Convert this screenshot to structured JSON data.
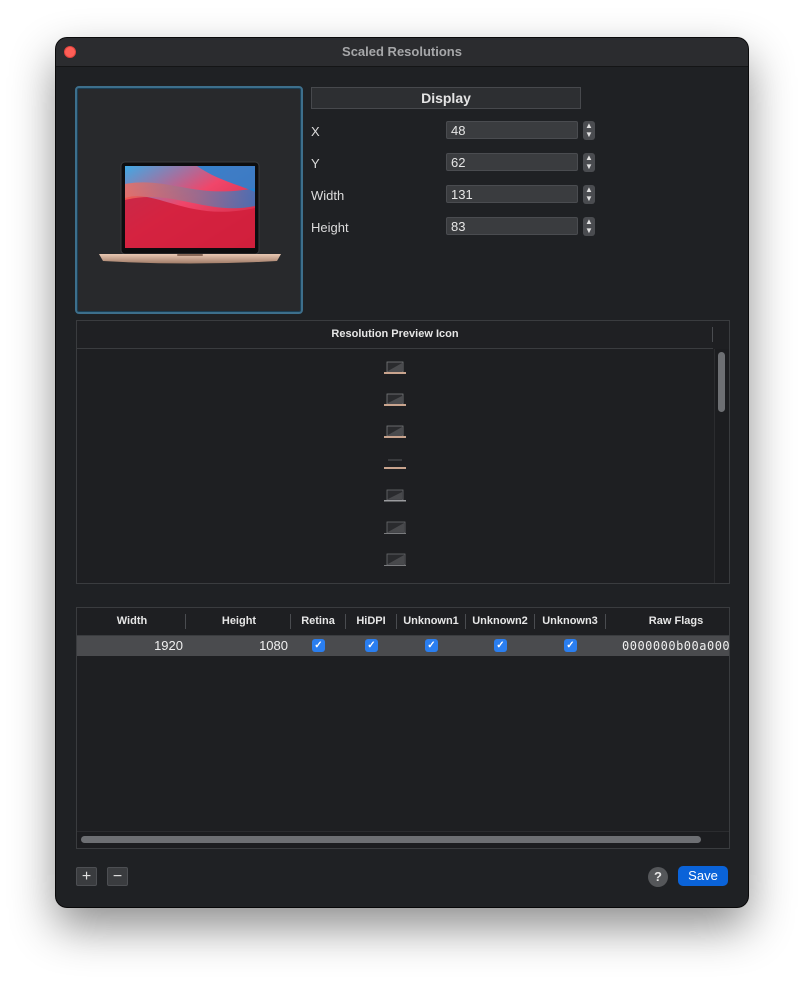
{
  "window": {
    "title": "Scaled Resolutions"
  },
  "display": {
    "header": "Display",
    "fields": [
      {
        "label": "X",
        "value": "48"
      },
      {
        "label": "Y",
        "value": "62"
      },
      {
        "label": "Width",
        "value": "131"
      },
      {
        "label": "Height",
        "value": "83"
      }
    ]
  },
  "preview_list": {
    "header": "Resolution Preview Icon"
  },
  "resolutions": {
    "columns": [
      "Width",
      "Height",
      "Retina",
      "HiDPI",
      "Unknown1",
      "Unknown2",
      "Unknown3",
      "Raw Flags"
    ],
    "rows": [
      {
        "width": "1920",
        "height": "1080",
        "retina": true,
        "hidpi": true,
        "unknown1": true,
        "unknown2": true,
        "unknown3": true,
        "raw_flags": "0000000b00a000"
      }
    ]
  },
  "footer": {
    "add_label": "+",
    "remove_label": "−",
    "help_label": "?",
    "save_label": "Save"
  },
  "colors": {
    "accent": "#0a63d9",
    "checkbox": "#2a7ef0",
    "close": "#fe5f57",
    "selection_ring": "#3d6f8c"
  }
}
